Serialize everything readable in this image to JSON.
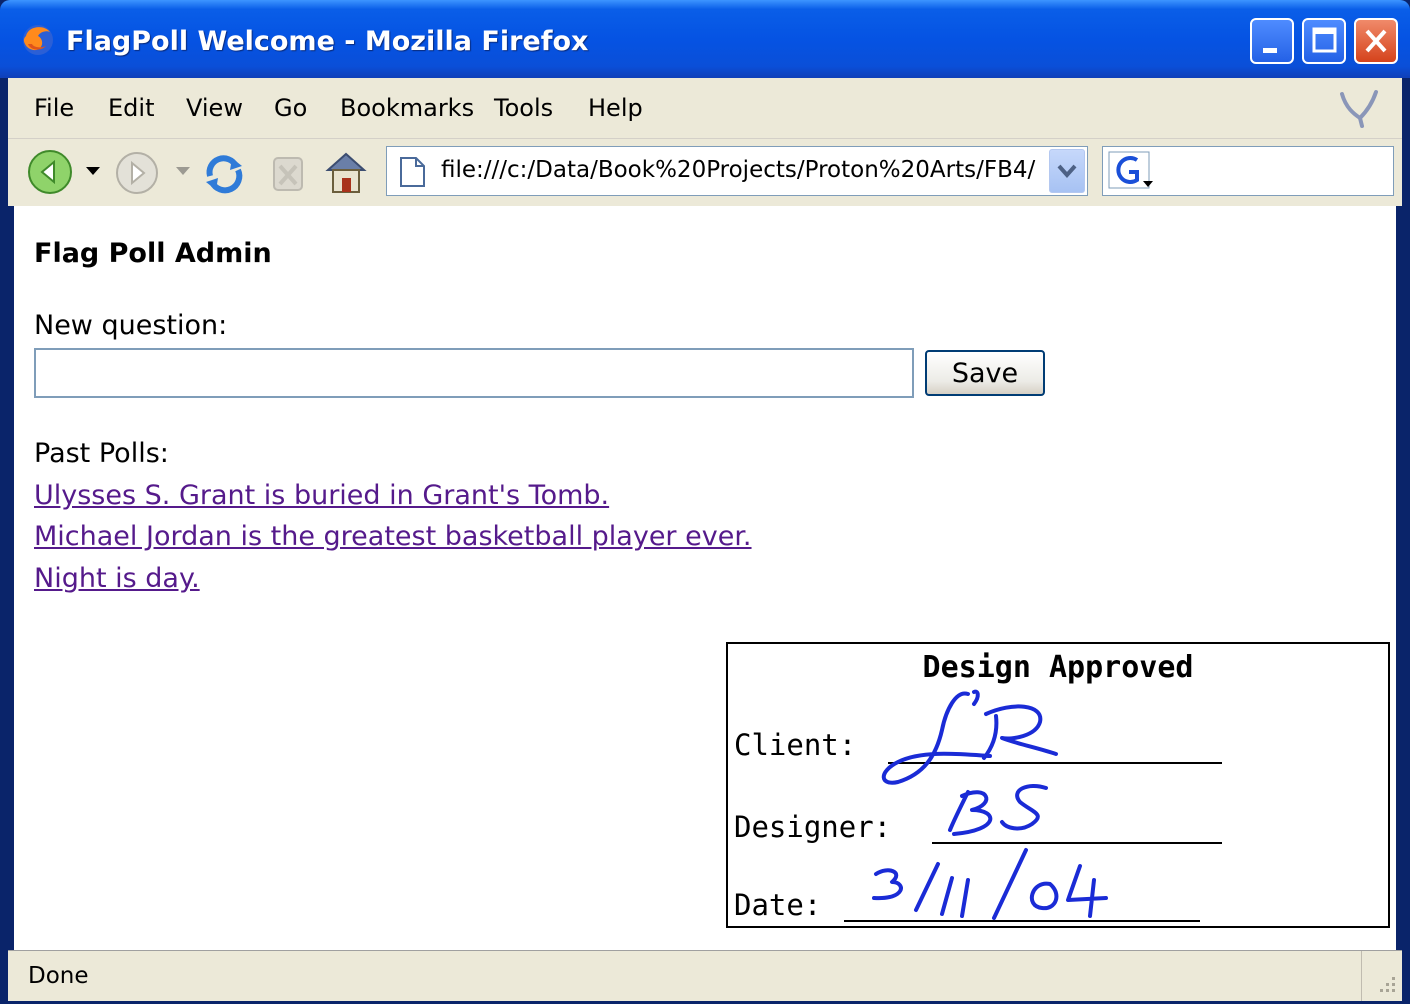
{
  "window": {
    "title": "FlagPoll Welcome - Mozilla Firefox",
    "accent": "#0553e3"
  },
  "menu": {
    "items": [
      "File",
      "Edit",
      "View",
      "Go",
      "Bookmarks",
      "Tools",
      "Help"
    ]
  },
  "toolbar": {
    "url": "file:///c:/Data/Book%20Projects/Proton%20Arts/FB4/",
    "search_engine_icon": "google-icon"
  },
  "page": {
    "title": "Flag Poll Admin",
    "new_question_label": "New question:",
    "question_value": "",
    "save_label": "Save",
    "past_polls_label": "Past Polls:",
    "polls": [
      "Ulysses S. Grant is buried in Grant's Tomb.",
      "Michael Jordan is the greatest basketball player ever.",
      "Night is day."
    ],
    "link_color": "#551a8b"
  },
  "stamp": {
    "title": "Design Approved",
    "client_label": "Client:",
    "designer_label": "Designer:",
    "date_label": "Date:",
    "client_signature": "JR",
    "designer_signature": "BS",
    "date_signature": "3/11/04",
    "ink_color": "#1a2bd6"
  },
  "status": {
    "text": "Done"
  }
}
